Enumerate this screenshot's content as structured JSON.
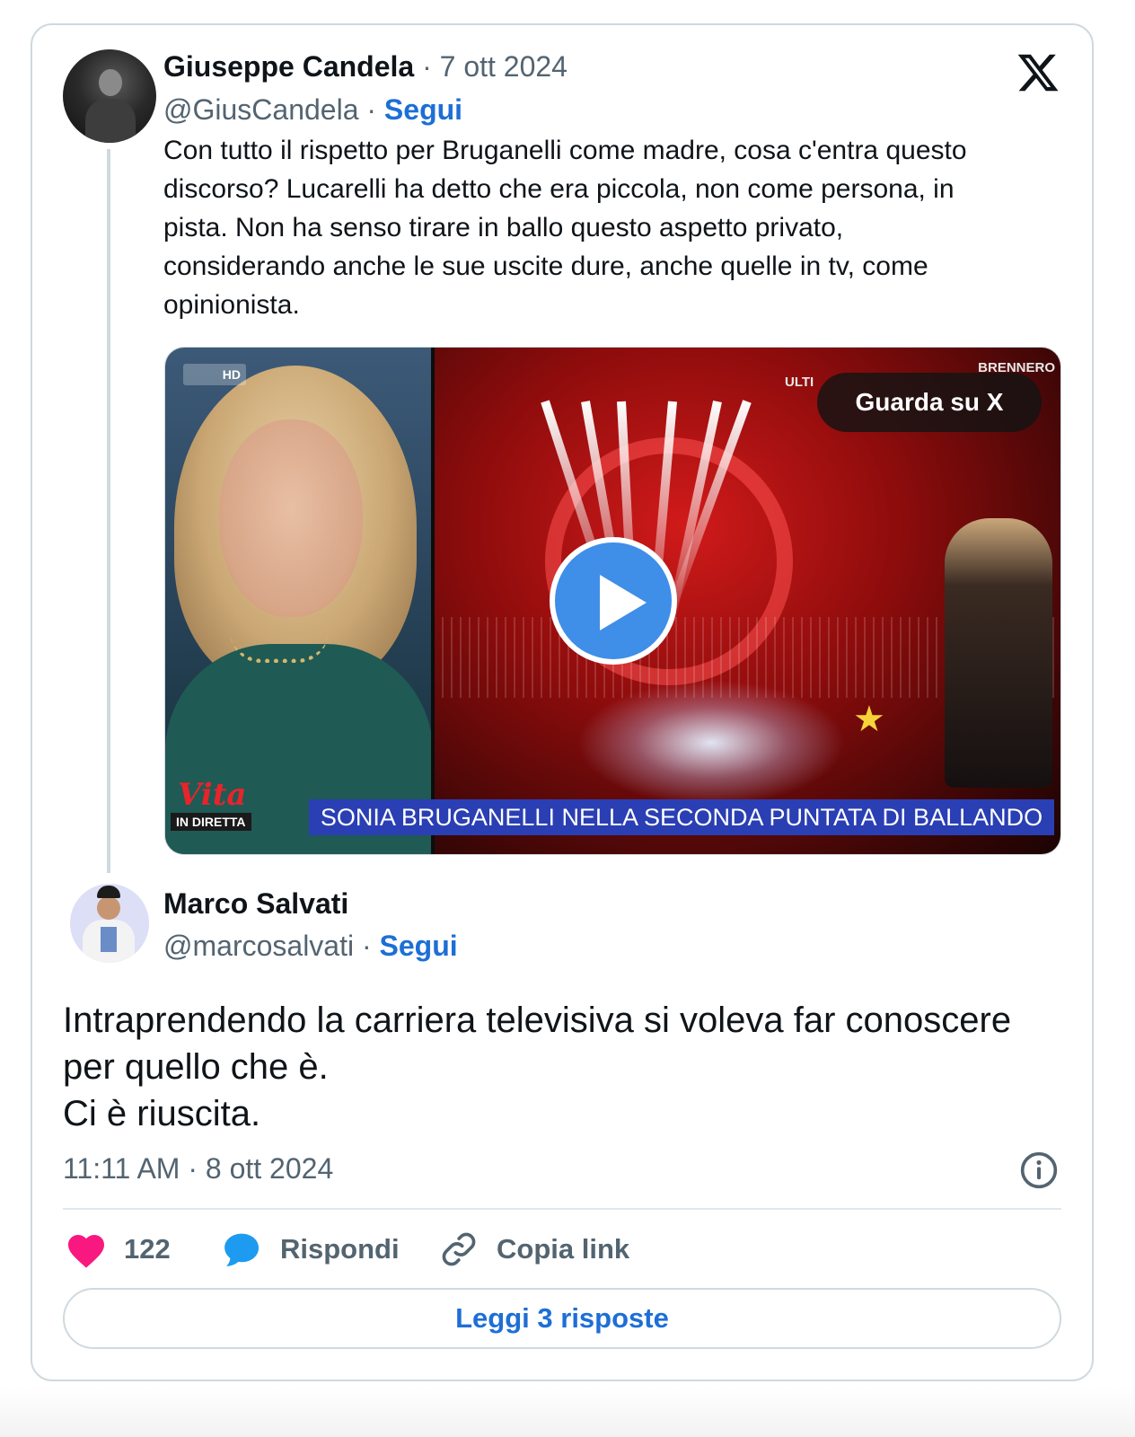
{
  "tweet1": {
    "author_name": "Giuseppe Candela",
    "date": " · 7 ott 2024",
    "handle": "@GiusCandela",
    "dot": " · ",
    "follow": "Segui",
    "text_lines": [
      "Con tutto il rispetto per Bruganelli come madre, cosa c'entra questo",
      "discorso?  Lucarelli ha detto che era piccola, non come persona, in",
      "pista. Non ha senso tirare in ballo questo aspetto privato,",
      "considerando anche le sue uscite dure, anche quelle in tv, come",
      "opinionista."
    ],
    "video": {
      "watch_label": "Guarda su X",
      "lower_third": "SONIA BRUGANELLI NELLA SECONDA PUNTATA DI BALLANDO",
      "logo_text": "Vita",
      "badge": "IN DIRETTA",
      "channel": "HD",
      "overlay_left": "ULTI",
      "overlay_right": "BRENNERO"
    }
  },
  "tweet2": {
    "author_name": "Marco Salvati",
    "handle": "@marcosalvati",
    "dot": " · ",
    "follow": "Segui",
    "text_lines": [
      "Intraprendendo la carriera televisiva si voleva far conoscere",
      "per quello che è.",
      "Ci è riuscita."
    ],
    "timestamp": "11:11 AM · 8 ott 2024"
  },
  "actions": {
    "likes": "122",
    "reply": "Rispondi",
    "copy_link": "Copia link"
  },
  "read_replies": "Leggi 3 risposte",
  "colors": {
    "accent": "#1d6fd6",
    "heart": "#f91880",
    "reply_icon": "#1d9bf0",
    "muted": "#536471",
    "play_button": "#3f8ee8"
  },
  "icons": [
    "x-logo-icon",
    "play-icon",
    "heart-icon",
    "reply-bubble-icon",
    "link-icon",
    "info-icon"
  ]
}
